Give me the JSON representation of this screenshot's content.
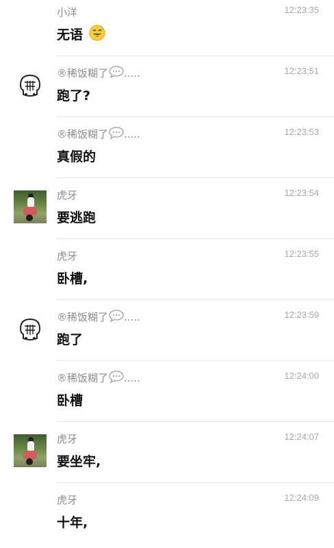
{
  "messages": [
    {
      "sender": "小洋",
      "time": "12:23:35",
      "text": "无语",
      "emoji": "sweat-smile-emoji",
      "avatar": "none"
    },
    {
      "sender": "®稀饭糊了",
      "sender_suffix": ".....",
      "time": "12:23:51",
      "text": "跑了?",
      "avatar": "cartoon-face"
    },
    {
      "sender": "®稀饭糊了",
      "sender_suffix": ".....",
      "time": "12:23:53",
      "text": "真假的",
      "avatar": "none"
    },
    {
      "sender": "虎牙",
      "time": "12:23:54",
      "text": "要逃跑",
      "avatar": "scooter-photo"
    },
    {
      "sender": "虎牙",
      "time": "12:23:55",
      "text": "卧槽,",
      "avatar": "none"
    },
    {
      "sender": "®稀饭糊了",
      "sender_suffix": ".....",
      "time": "12:23:59",
      "text": "跑了",
      "avatar": "cartoon-face"
    },
    {
      "sender": "®稀饭糊了",
      "sender_suffix": ".....",
      "time": "12:24:00",
      "text": "卧槽",
      "avatar": "none"
    },
    {
      "sender": "虎牙",
      "time": "12:24:07",
      "text": "要坐牢,",
      "avatar": "scooter-photo"
    },
    {
      "sender": "虎牙",
      "time": "12:24:09",
      "text": "十年,",
      "avatar": "none"
    }
  ]
}
